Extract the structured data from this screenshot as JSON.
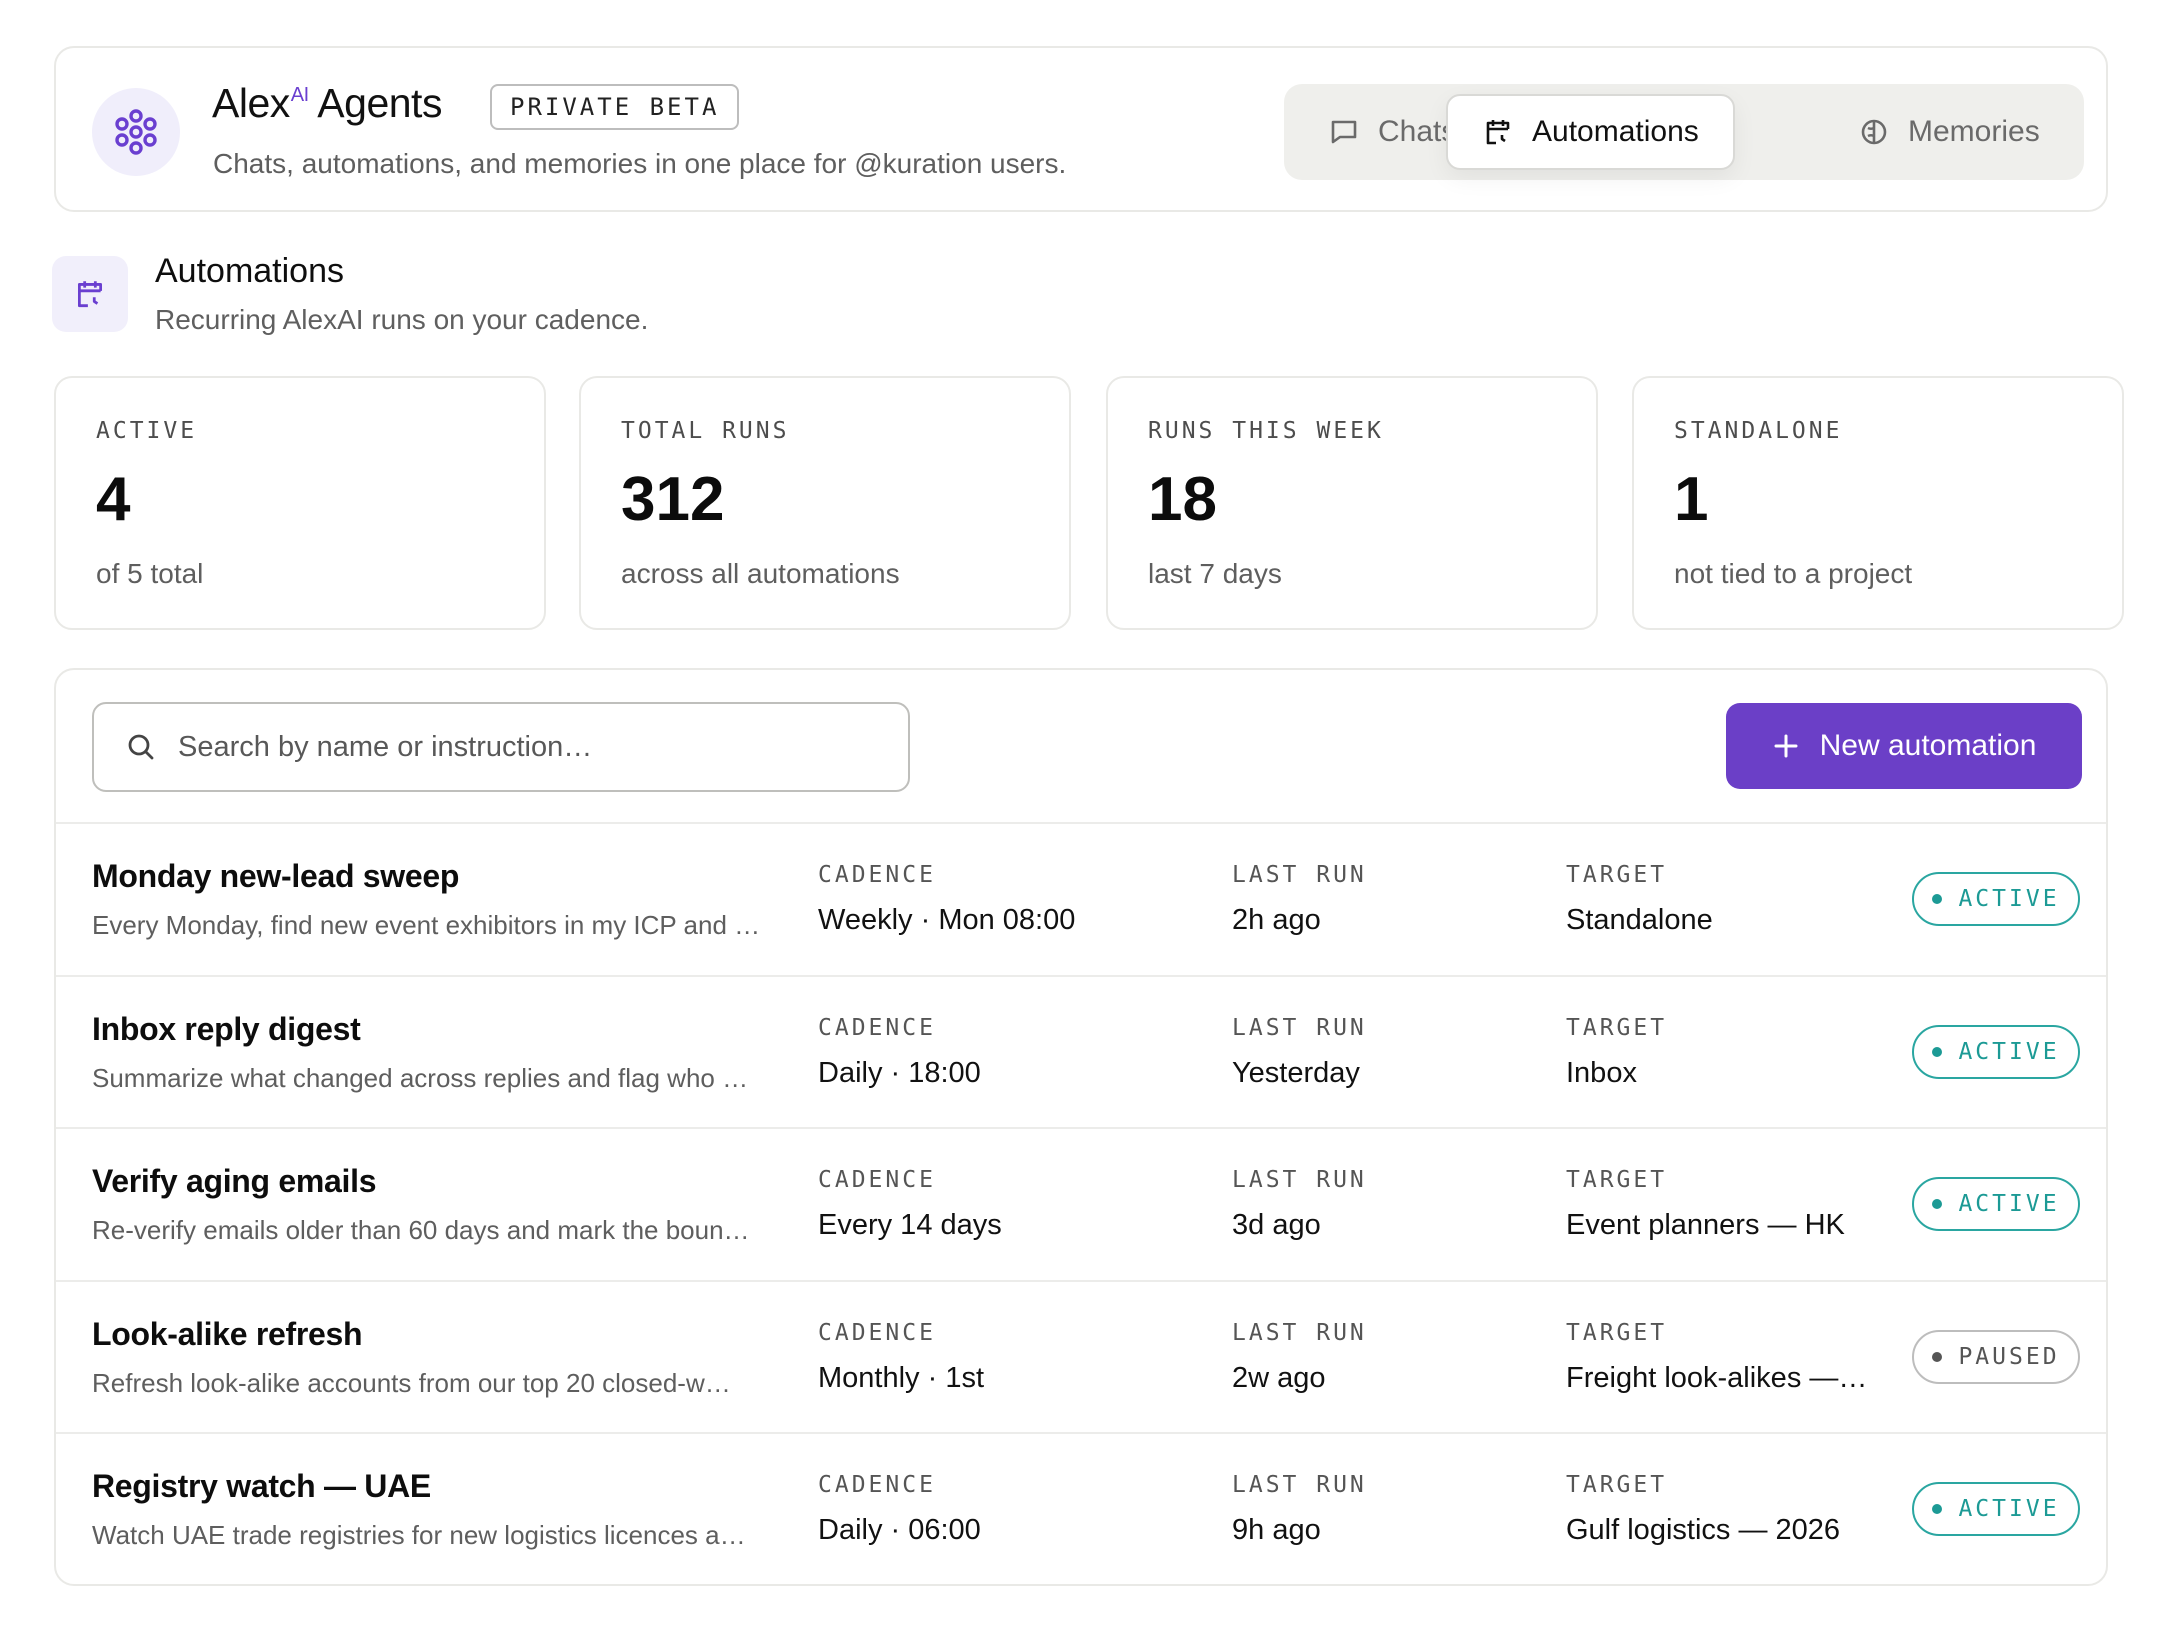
{
  "header": {
    "brand_name": "Alex",
    "brand_sup": "AI",
    "brand_suffix": " Agents",
    "beta_badge": "PRIVATE BETA",
    "subtitle": "Chats, automations, and memories in one place for @kuration users.",
    "tabs": [
      {
        "label": "Chats",
        "icon": "chat-bubble-icon",
        "active": false
      },
      {
        "label": "Automations",
        "icon": "calendar-clock-icon",
        "active": true
      },
      {
        "label": "Memories",
        "icon": "brain-icon",
        "active": false
      }
    ]
  },
  "section": {
    "title": "Automations",
    "subtitle": "Recurring AlexAI runs on your cadence.",
    "icon": "calendar-clock-icon"
  },
  "stats": [
    {
      "label": "ACTIVE",
      "value": "4",
      "note": "of 5 total"
    },
    {
      "label": "TOTAL RUNS",
      "value": "312",
      "note": "across all automations"
    },
    {
      "label": "RUNS THIS WEEK",
      "value": "18",
      "note": "last 7 days"
    },
    {
      "label": "STANDALONE",
      "value": "1",
      "note": "not tied to a project"
    }
  ],
  "toolbar": {
    "search_placeholder": "Search by name or instruction…",
    "new_button": "New automation"
  },
  "column_labels": {
    "cadence": "CADENCE",
    "last_run": "LAST RUN",
    "target": "TARGET"
  },
  "automations": [
    {
      "name": "Monday new-lead sweep",
      "desc": "Every Monday, find new event exhibitors in my ICP and …",
      "cadence": "Weekly · Mon 08:00",
      "last_run": "2h ago",
      "target": "Standalone",
      "status": "ACTIVE"
    },
    {
      "name": "Inbox reply digest",
      "desc": "Summarize what changed across replies and flag who …",
      "cadence": "Daily · 18:00",
      "last_run": "Yesterday",
      "target": "Inbox",
      "status": "ACTIVE"
    },
    {
      "name": "Verify aging emails",
      "desc": "Re-verify emails older than 60 days and mark the boun…",
      "cadence": "Every 14 days",
      "last_run": "3d ago",
      "target": "Event planners — HK",
      "status": "ACTIVE"
    },
    {
      "name": "Look-alike refresh",
      "desc": "Refresh look-alike accounts from our top 20 closed-w…",
      "cadence": "Monthly · 1st",
      "last_run": "2w ago",
      "target": "Freight look-alikes —…",
      "status": "PAUSED"
    },
    {
      "name": "Registry watch — UAE",
      "desc": "Watch UAE trade registries for new logistics licences a…",
      "cadence": "Daily · 06:00",
      "last_run": "9h ago",
      "target": "Gulf logistics — 2026",
      "status": "ACTIVE"
    }
  ],
  "colors": {
    "accent": "#6b3fc7",
    "active": "#1c9a95",
    "paused": "#555555"
  }
}
